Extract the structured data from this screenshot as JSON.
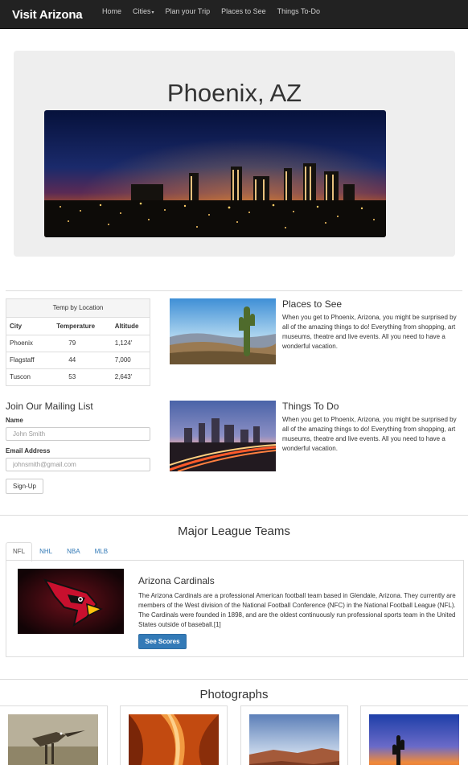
{
  "navbar": {
    "brand": "Visit Arizona",
    "items": [
      {
        "label": "Home"
      },
      {
        "label": "Cities"
      },
      {
        "label": "Plan your Trip"
      },
      {
        "label": "Places to See"
      },
      {
        "label": "Things To-Do"
      }
    ],
    "dropdown_icon": "caret-down-icon"
  },
  "jumbotron": {
    "title": "Phoenix, AZ"
  },
  "temperature": {
    "heading": "Temp by Location",
    "columns": [
      "City",
      "Temperature",
      "Altitude"
    ],
    "rows": [
      [
        "Phoenix",
        "79",
        "1,124'"
      ],
      [
        "Flagstaff",
        "44",
        "7,000"
      ],
      [
        "Tuscon",
        "53",
        "2,643'"
      ]
    ]
  },
  "places": {
    "title": "Places to See",
    "text": "When you get to Phoenix, Arizona, you might be surprised by all of the amazing things to do! Everything from shopping, art museums, theatre and live events. All you need to have a wonderful vacation."
  },
  "things": {
    "title": "Things To Do",
    "text": "When you get to Phoenix, Arizona, you might be surprised by all of the amazing things to do! Everything from shopping, art museums, theatre and live events. All you need to have a wonderful vacation."
  },
  "mailing": {
    "title": "Join Our Mailing List",
    "name_label": "Name",
    "name_placeholder": "John Smith",
    "email_label": "Email Address",
    "email_placeholder": "johnsmith@gmail.com",
    "submit_label": "Sign-Up"
  },
  "teams": {
    "title": "Major League Teams",
    "tabs": [
      {
        "label": "NFL",
        "active": true
      },
      {
        "label": "NHL"
      },
      {
        "label": "NBA"
      },
      {
        "label": "MLB"
      }
    ],
    "active": {
      "name": "Arizona Cardinals",
      "text": "The Arizona Cardinals are a professional American football team based in Glendale, Arizona. They currently are members of the West division of the National Football Conference (NFC) in the National Football League (NFL). The Cardinals were founded in 1898, and are the oldest continuously run professional sports team in the United States outside of baseball.[1]",
      "button_label": "See Scores"
    }
  },
  "photographs": {
    "title": "Photographs"
  },
  "colors": {
    "navbar": "#222222",
    "jumbotron": "#eeeeee",
    "link": "#337ab7",
    "primary_button": "#337ab7"
  }
}
